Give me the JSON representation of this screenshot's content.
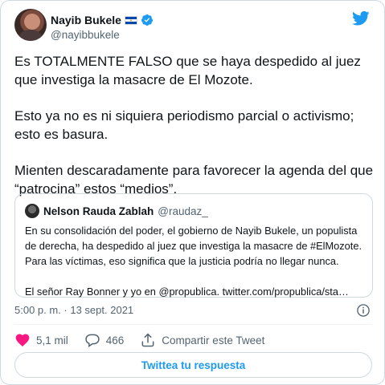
{
  "author": {
    "name": "Nayib Bukele",
    "handle": "@nayibbukele"
  },
  "tweet": {
    "paragraphs": [
      "Es TOTALMENTE FALSO que se haya despedido al juez que investiga la masacre de El Mozote.",
      "Esto ya no es ni siquiera periodismo parcial o activismo; esto es basura.",
      "Mienten descaradamente para favorecer la agenda del que “patrocina” estos “medios”."
    ]
  },
  "quoted": {
    "name": "Nelson Rauda Zablah",
    "handle": "@raudaz_",
    "paragraphs": [
      "En su consolidación del poder, el gobierno de Nayib Bukele, un populista de derecha, ha despedido al juez que investiga la masacre de #ElMozote. Para las víctimas, eso significa que la justicia podría no llegar nunca.",
      "El señor Ray Bonner y yo en @propublica. twitter.com/propublica/sta…"
    ]
  },
  "meta": {
    "timestamp": "5:00 p. m. · 13 sept. 2021"
  },
  "actions": {
    "likes": "5,1 mil",
    "replies": "466",
    "share_label": "Compartir este Tweet"
  },
  "reply_button": {
    "label": "Twittea tu respuesta"
  },
  "colors": {
    "accent": "#1d9bf0",
    "like_red": "#f91880",
    "muted": "#536471",
    "border": "#cfd9de"
  }
}
